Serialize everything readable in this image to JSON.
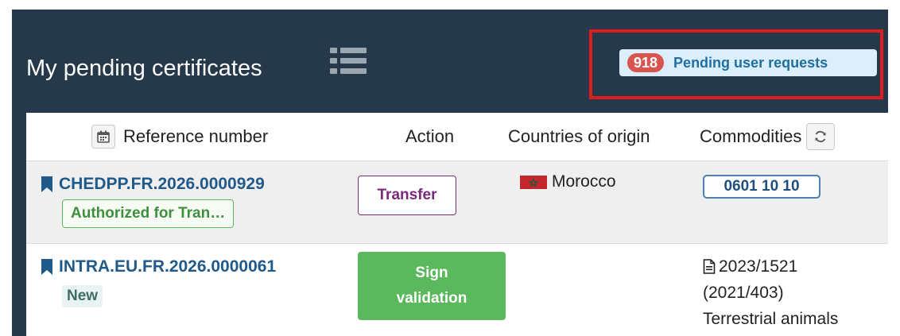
{
  "panel": {
    "title": "My pending certificates",
    "pending_requests": {
      "count": "918",
      "label": "Pending user requests"
    }
  },
  "table": {
    "headers": {
      "reference": "Reference number",
      "action": "Action",
      "countries": "Countries of origin",
      "commodities": "Commodities"
    },
    "rows": [
      {
        "reference": "CHEDPP.FR.2026.0000929",
        "status": "Authorized for Tran…",
        "action": "Transfer",
        "country": "Morocco",
        "commodity": "0601 10 10"
      },
      {
        "reference": "INTRA.EU.FR.2026.0000061",
        "status": "New",
        "action_line1": "Sign",
        "action_line2": "validation",
        "reg_line1": "2023/1521",
        "reg_line2": "(2021/403)",
        "reg_line3": "Terrestrial animals"
      }
    ]
  },
  "colors": {
    "panel_bg": "#25394a",
    "highlight_border": "#e01c1c",
    "count_badge": "#d9534f",
    "link": "#1f5a8a",
    "transfer": "#7b2a7b",
    "sign": "#5cb85c"
  },
  "icons": [
    "list-icon",
    "calendar-icon",
    "refresh-icon",
    "bookmark-icon",
    "document-icon",
    "flag-morocco-icon"
  ]
}
